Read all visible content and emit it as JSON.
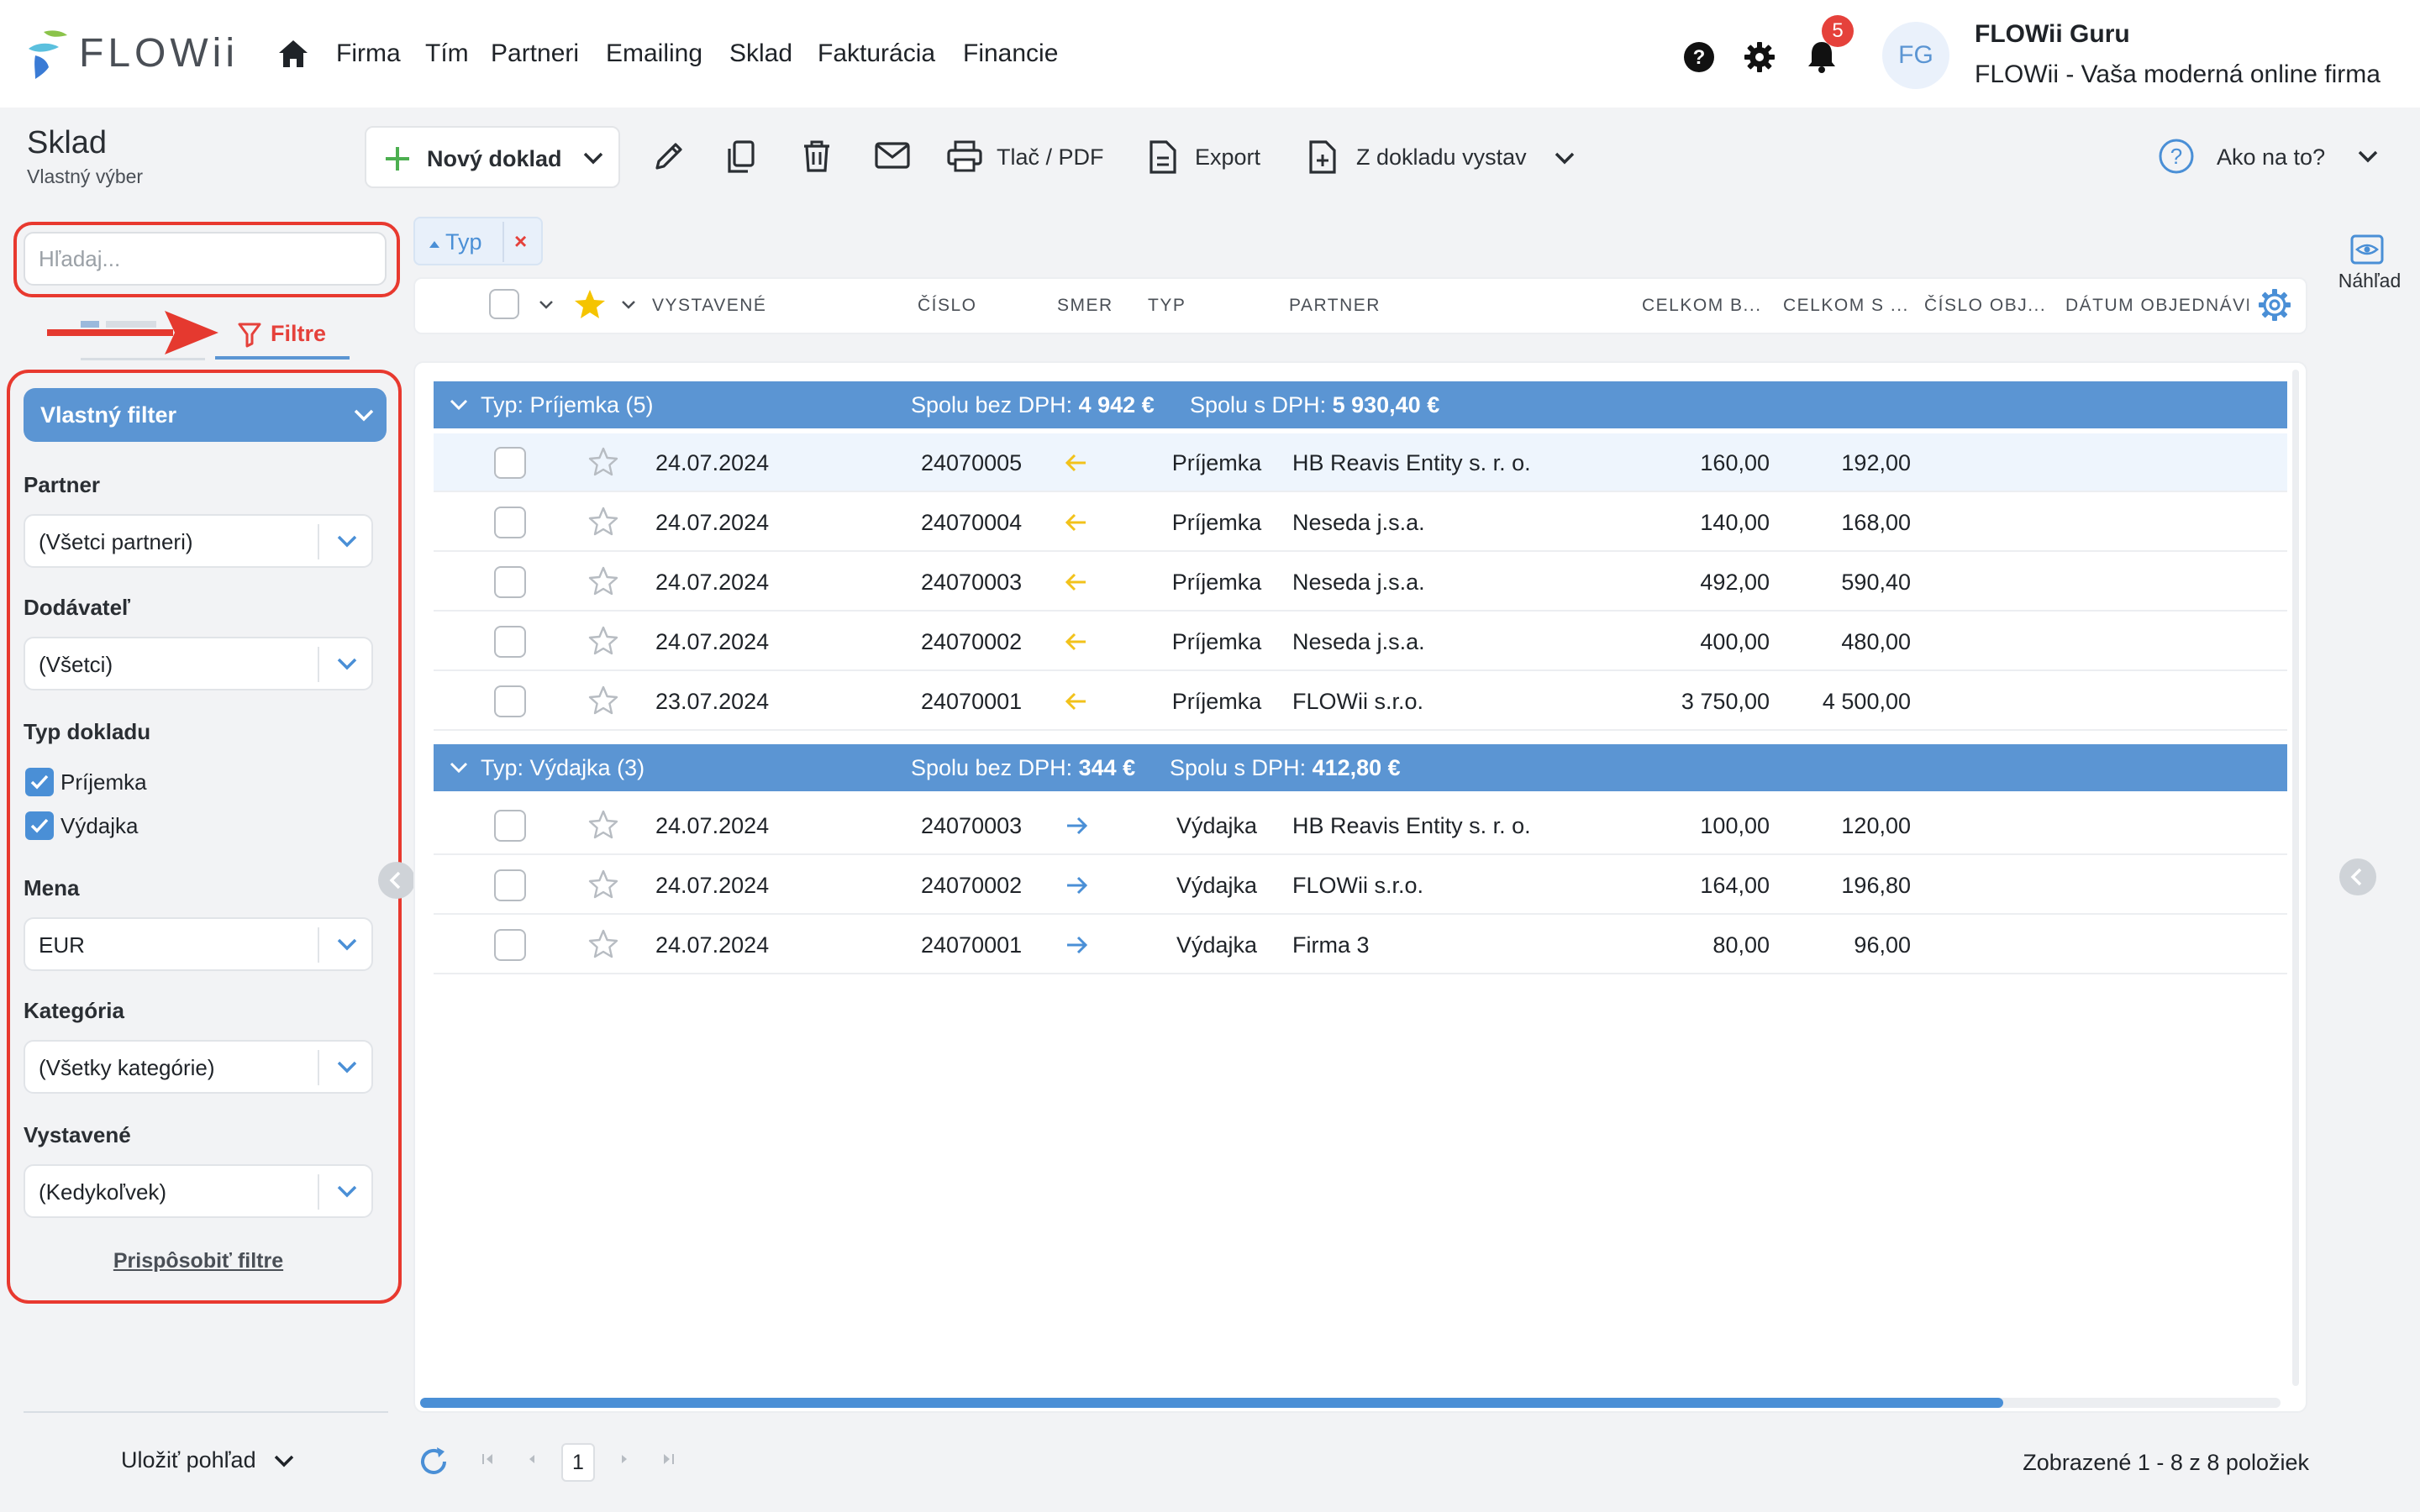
{
  "brand": {
    "logo_text": "FLOWii"
  },
  "nav": {
    "items": [
      "Firma",
      "Tím",
      "Partneri",
      "Emailing",
      "Sklad",
      "Fakturácia",
      "Financie"
    ]
  },
  "header_right": {
    "notification_count": "5",
    "avatar_initials": "FG",
    "user_name": "FLOWii Guru",
    "company_name": "FLOWii - Vaša moderná online firma"
  },
  "module": {
    "title": "Sklad",
    "subtitle": "Vlastný výber"
  },
  "toolbar": {
    "new_doc_label": "Nový doklad",
    "print_label": "Tlač / PDF",
    "export_label": "Export",
    "from_doc_label": "Z dokladu vystav",
    "help_label": "Ako na to?"
  },
  "sidebar": {
    "search_placeholder": "Hľadaj...",
    "filters_tab_label": "Filtre",
    "custom_filter_label": "Vlastný filter",
    "partner": {
      "label": "Partner",
      "value": "(Všetci partneri)"
    },
    "supplier": {
      "label": "Dodávateľ",
      "value": "(Všetci)"
    },
    "doc_type": {
      "label": "Typ dokladu",
      "options": [
        "Príjemka",
        "Výdajka"
      ]
    },
    "currency": {
      "label": "Mena",
      "value": "EUR"
    },
    "category": {
      "label": "Kategória",
      "value": "(Všetky kategórie)"
    },
    "issued": {
      "label": "Vystavené",
      "value": "(Kedykoľvek)"
    },
    "customize_label": "Prispôsobiť filtre",
    "save_view_label": "Uložiť pohľad"
  },
  "grid": {
    "group_chip_label": "Typ",
    "group_chip_remove": "×",
    "columns": [
      "Vystavené",
      "Číslo",
      "Smer",
      "Typ",
      "Partner",
      "Celkom b...",
      "Celkom s ...",
      "Číslo obj...",
      "Dátum objednávk"
    ],
    "groups": [
      {
        "title": "Typ: Príjemka (5)",
        "sum_net_label": "Spolu bez DPH:",
        "sum_net": "4 942 €",
        "sum_gross_label": "Spolu s DPH:",
        "sum_gross": "5 930,40 €",
        "rows": [
          {
            "date": "24.07.2024",
            "number": "24070005",
            "direction": "in",
            "type": "Príjemka",
            "partner": "HB Reavis Entity s. r. o.",
            "net": "160,00",
            "gross": "192,00"
          },
          {
            "date": "24.07.2024",
            "number": "24070004",
            "direction": "in",
            "type": "Príjemka",
            "partner": "Neseda j.s.a.",
            "net": "140,00",
            "gross": "168,00"
          },
          {
            "date": "24.07.2024",
            "number": "24070003",
            "direction": "in",
            "type": "Príjemka",
            "partner": "Neseda j.s.a.",
            "net": "492,00",
            "gross": "590,40"
          },
          {
            "date": "24.07.2024",
            "number": "24070002",
            "direction": "in",
            "type": "Príjemka",
            "partner": "Neseda j.s.a.",
            "net": "400,00",
            "gross": "480,00"
          },
          {
            "date": "23.07.2024",
            "number": "24070001",
            "direction": "in",
            "type": "Príjemka",
            "partner": "FLOWii s.r.o.",
            "net": "3 750,00",
            "gross": "4 500,00"
          }
        ]
      },
      {
        "title": "Typ: Výdajka (3)",
        "sum_net_label": "Spolu bez DPH:",
        "sum_net": "344 €",
        "sum_gross_label": "Spolu s DPH:",
        "sum_gross": "412,80 €",
        "rows": [
          {
            "date": "24.07.2024",
            "number": "24070003",
            "direction": "out",
            "type": "Výdajka",
            "partner": "HB Reavis Entity s. r. o.",
            "net": "100,00",
            "gross": "120,00"
          },
          {
            "date": "24.07.2024",
            "number": "24070002",
            "direction": "out",
            "type": "Výdajka",
            "partner": "FLOWii s.r.o.",
            "net": "164,00",
            "gross": "196,80"
          },
          {
            "date": "24.07.2024",
            "number": "24070001",
            "direction": "out",
            "type": "Výdajka",
            "partner": "Firma 3",
            "net": "80,00",
            "gross": "96,00"
          }
        ]
      }
    ]
  },
  "pager": {
    "current_page": "1",
    "info": "Zobrazené 1 - 8 z 8 položiek"
  },
  "right_rail": {
    "preview_label": "Náhľad"
  },
  "colors": {
    "accent": "#5b95d3",
    "danger": "#e5413b",
    "star": "#f5c400",
    "in_arrow": "#f2c21b",
    "out_arrow": "#4a8fd6",
    "plus": "#4caf50"
  }
}
